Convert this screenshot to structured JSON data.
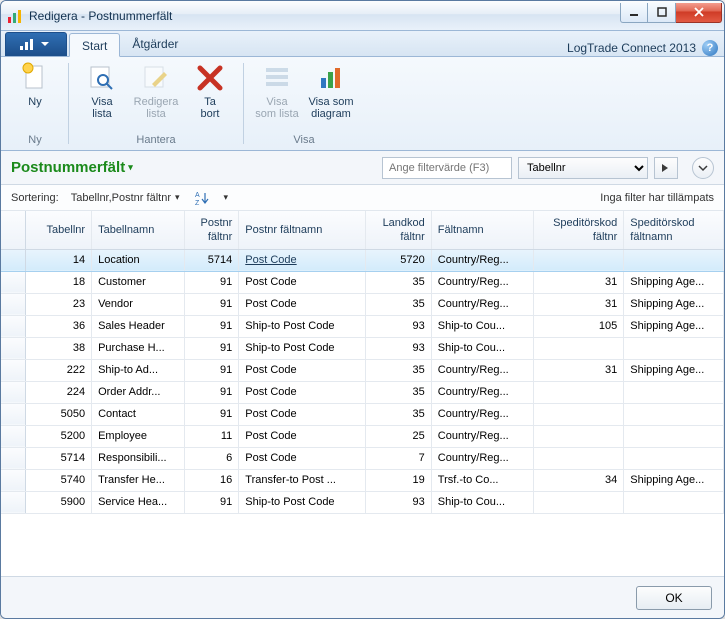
{
  "window": {
    "title": "Redigera - Postnummerfält"
  },
  "ribbon": {
    "brand": "LogTrade Connect 2013",
    "tabs": {
      "start": "Start",
      "actions": "Åtgärder"
    },
    "groups": {
      "ny": {
        "label": "Ny",
        "new": "Ny"
      },
      "hantera": {
        "label": "Hantera",
        "visa_lista": "Visa\nlista",
        "redigera_lista": "Redigera\nlista",
        "ta_bort": "Ta\nbort"
      },
      "visa": {
        "label": "Visa",
        "visa_som_lista": "Visa\nsom lista",
        "visa_som_diagram": "Visa som\ndiagram"
      }
    }
  },
  "page": {
    "title": "Postnummerfält"
  },
  "filter": {
    "placeholder": "Ange filtervärde (F3)",
    "field": "Tabellnr",
    "none_applied": "Inga filter har tillämpats"
  },
  "sort": {
    "label": "Sortering:",
    "value": "Tabellnr,Postnr fältnr"
  },
  "columns": {
    "tabellnr": "Tabellnr",
    "tabellnamn": "Tabellnamn",
    "postnr_faltnr": "Postnr\nfältnr",
    "postnr_faltnamn": "Postnr fältnamn",
    "landkod_faltnr": "Landkod\nfältnr",
    "faltnamn": "Fältnamn",
    "speditorskod_faltnr": "Speditörskod\nfältnr",
    "speditorskod_faltnamn": "Speditörskod\nfältnamn"
  },
  "rows": [
    {
      "tabellnr": 14,
      "tabellnamn": "Location",
      "postnr_faltnr": 5714,
      "postnr_faltnamn": "Post Code",
      "landkod_faltnr": 5720,
      "faltnamn": "Country/Reg...",
      "sped_nr": "",
      "sped_namn": "",
      "selected": true
    },
    {
      "tabellnr": 18,
      "tabellnamn": "Customer",
      "postnr_faltnr": 91,
      "postnr_faltnamn": "Post Code",
      "landkod_faltnr": 35,
      "faltnamn": "Country/Reg...",
      "sped_nr": 31,
      "sped_namn": "Shipping Age..."
    },
    {
      "tabellnr": 23,
      "tabellnamn": "Vendor",
      "postnr_faltnr": 91,
      "postnr_faltnamn": "Post Code",
      "landkod_faltnr": 35,
      "faltnamn": "Country/Reg...",
      "sped_nr": 31,
      "sped_namn": "Shipping Age..."
    },
    {
      "tabellnr": 36,
      "tabellnamn": "Sales Header",
      "postnr_faltnr": 91,
      "postnr_faltnamn": "Ship-to Post Code",
      "landkod_faltnr": 93,
      "faltnamn": "Ship-to Cou...",
      "sped_nr": 105,
      "sped_namn": "Shipping Age..."
    },
    {
      "tabellnr": 38,
      "tabellnamn": "Purchase H...",
      "postnr_faltnr": 91,
      "postnr_faltnamn": "Ship-to Post Code",
      "landkod_faltnr": 93,
      "faltnamn": "Ship-to Cou...",
      "sped_nr": "",
      "sped_namn": ""
    },
    {
      "tabellnr": 222,
      "tabellnamn": "Ship-to Ad...",
      "postnr_faltnr": 91,
      "postnr_faltnamn": "Post Code",
      "landkod_faltnr": 35,
      "faltnamn": "Country/Reg...",
      "sped_nr": 31,
      "sped_namn": "Shipping Age..."
    },
    {
      "tabellnr": 224,
      "tabellnamn": "Order Addr...",
      "postnr_faltnr": 91,
      "postnr_faltnamn": "Post Code",
      "landkod_faltnr": 35,
      "faltnamn": "Country/Reg...",
      "sped_nr": "",
      "sped_namn": ""
    },
    {
      "tabellnr": 5050,
      "tabellnamn": "Contact",
      "postnr_faltnr": 91,
      "postnr_faltnamn": "Post Code",
      "landkod_faltnr": 35,
      "faltnamn": "Country/Reg...",
      "sped_nr": "",
      "sped_namn": ""
    },
    {
      "tabellnr": 5200,
      "tabellnamn": "Employee",
      "postnr_faltnr": 11,
      "postnr_faltnamn": "Post Code",
      "landkod_faltnr": 25,
      "faltnamn": "Country/Reg...",
      "sped_nr": "",
      "sped_namn": ""
    },
    {
      "tabellnr": 5714,
      "tabellnamn": "Responsibili...",
      "postnr_faltnr": 6,
      "postnr_faltnamn": "Post Code",
      "landkod_faltnr": 7,
      "faltnamn": "Country/Reg...",
      "sped_nr": "",
      "sped_namn": ""
    },
    {
      "tabellnr": 5740,
      "tabellnamn": "Transfer He...",
      "postnr_faltnr": 16,
      "postnr_faltnamn": "Transfer-to Post ...",
      "landkod_faltnr": 19,
      "faltnamn": "Trsf.-to Co...",
      "sped_nr": 34,
      "sped_namn": "Shipping Age..."
    },
    {
      "tabellnr": 5900,
      "tabellnamn": "Service Hea...",
      "postnr_faltnr": 91,
      "postnr_faltnamn": "Ship-to Post Code",
      "landkod_faltnr": 93,
      "faltnamn": "Ship-to Cou...",
      "sped_nr": "",
      "sped_namn": ""
    }
  ],
  "footer": {
    "ok": "OK"
  }
}
